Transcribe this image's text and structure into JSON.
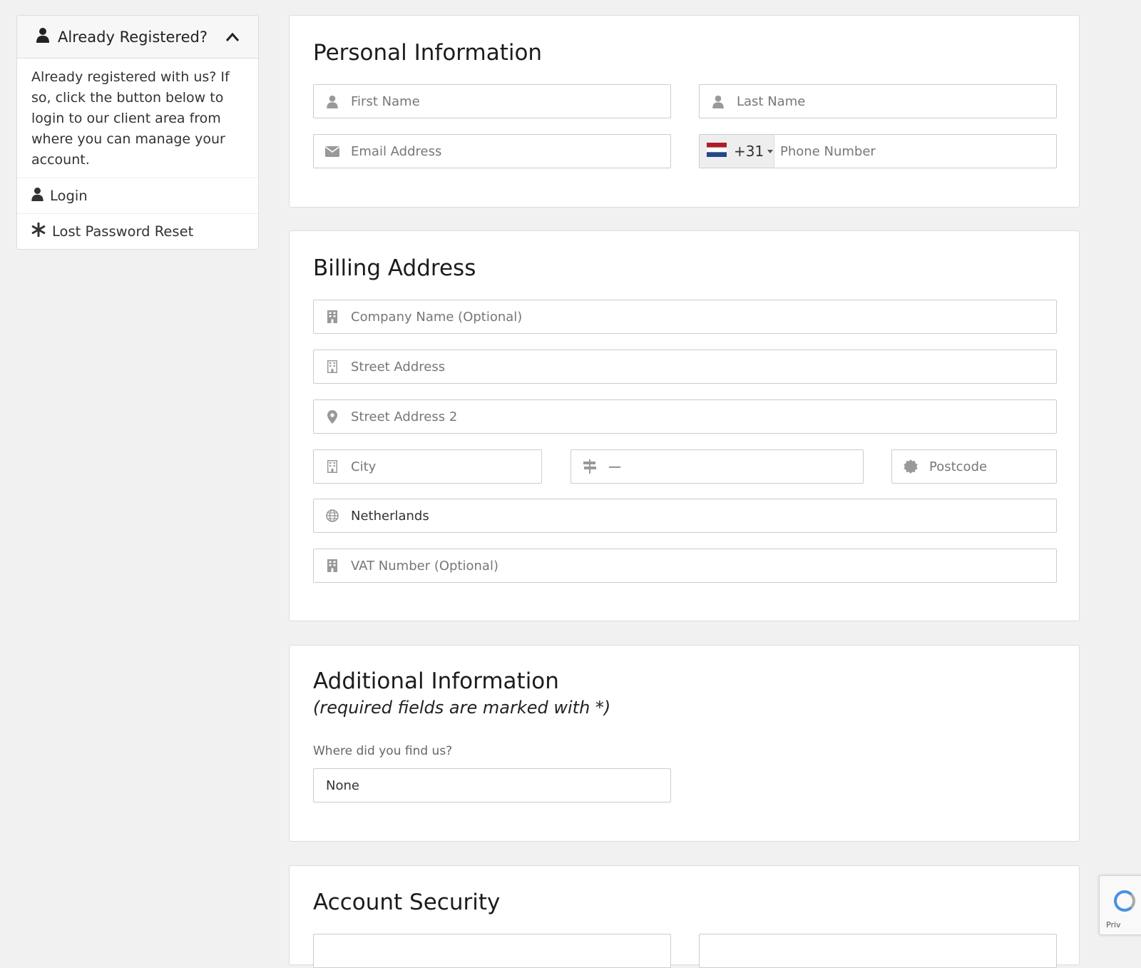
{
  "sidebar": {
    "title": "Already Registered?",
    "body": "Already registered with us? If so, click the button below to login to our client area from where you can manage your account.",
    "items": [
      {
        "label": "Login",
        "icon": "user-icon"
      },
      {
        "label": "Lost Password Reset",
        "icon": "asterisk-icon"
      }
    ]
  },
  "personal": {
    "title": "Personal Information",
    "first_name_placeholder": "First Name",
    "last_name_placeholder": "Last Name",
    "email_placeholder": "Email Address",
    "country_code": "+31",
    "phone_placeholder": "Phone Number"
  },
  "billing": {
    "title": "Billing Address",
    "company_placeholder": "Company Name (Optional)",
    "street_placeholder": "Street Address",
    "street2_placeholder": "Street Address 2",
    "city_placeholder": "City",
    "state_value": "—",
    "postcode_placeholder": "Postcode",
    "country_value": "Netherlands",
    "vat_placeholder": "VAT Number (Optional)"
  },
  "additional": {
    "title": "Additional Information",
    "subtitle": "(required fields are marked with *)",
    "question_label": "Where did you find us?",
    "question_value": "None"
  },
  "security": {
    "title": "Account Security"
  },
  "recaptcha": {
    "text": "Priv"
  },
  "colors": {
    "icon": "#999999",
    "border": "#cccccc",
    "flag_red": "#ae1c28",
    "flag_blue": "#21468b"
  }
}
